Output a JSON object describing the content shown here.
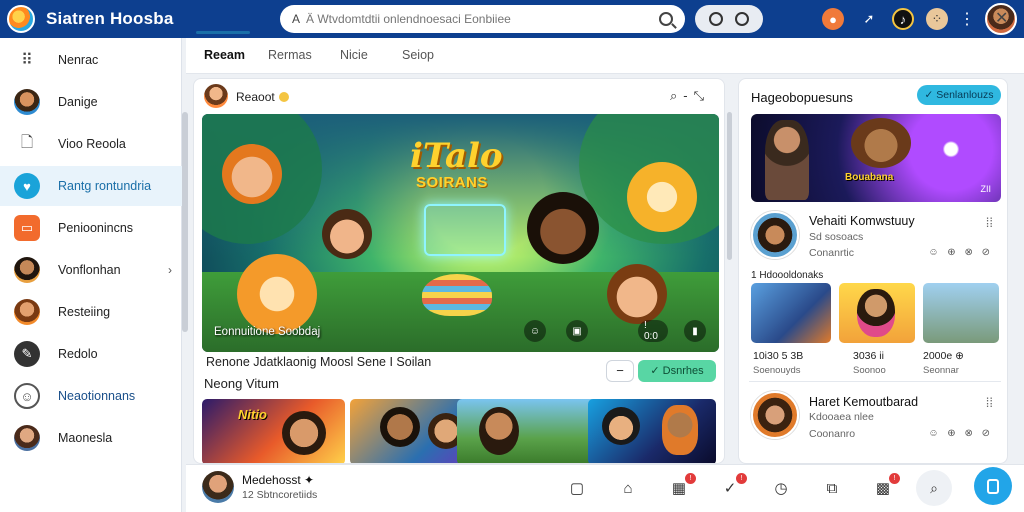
{
  "app": {
    "title": "Siatren Hoosba"
  },
  "search": {
    "placeholder": "Ä Wtvdomtdtii onlendnoesaci Eonbiiee",
    "pre_icon": "A"
  },
  "sidebar": {
    "items": [
      {
        "label": "Nenrac",
        "icon": "grid-icon"
      },
      {
        "label": "Danige",
        "icon": "avatar-icon"
      },
      {
        "label": "Vioo Reoola",
        "icon": "document-icon"
      },
      {
        "label": "Rantg rontundria",
        "icon": "heart-icon",
        "active": true
      },
      {
        "label": "Penioonincns",
        "icon": "chat-icon"
      },
      {
        "label": "Vonflonhan",
        "icon": "avatar-icon"
      },
      {
        "label": "Resteiing",
        "icon": "avatar-icon"
      },
      {
        "label": "Redolo",
        "icon": "pencil-icon"
      },
      {
        "label": "Neaotionnans",
        "icon": "face-icon"
      },
      {
        "label": "Maonesla",
        "icon": "avatar-icon"
      }
    ]
  },
  "tabs": [
    {
      "label": "Reeam",
      "active": true
    },
    {
      "label": "Rermas"
    },
    {
      "label": "Nicie"
    },
    {
      "label": "Seiop"
    }
  ],
  "main": {
    "header_name": "Reaoot",
    "hero": {
      "title": "iTalo",
      "subtitle": "SOIRANS",
      "caption": "Eonnuitione Soobdaj",
      "ctrl_time": "! 0:0"
    },
    "info_line": "Renone Jdatklaonig Moosl Sene I Soilan",
    "section_title": "Neong Vitum",
    "green_button": "✓ Dsnrhes",
    "thumbnails": [
      {
        "label": "Nitio"
      },
      {
        "label": ""
      },
      {
        "label": ""
      },
      {
        "label": ""
      }
    ]
  },
  "right_panel": {
    "title": "Hageobopuesuns",
    "button": "✓ Senlanlouzs",
    "banner": {
      "label": "Bouabana",
      "tag": "ZII"
    },
    "entries": [
      {
        "name": "Vehaiti Komwstuuy",
        "sub1": "Sd sosoacs",
        "sub2": "Conanrtic",
        "reacts": "☺ ⊕ ⊗ ⊘"
      },
      {
        "name": "Haret Kemoutbarad",
        "sub1": "Kdooaea nlee",
        "sub2": "Coonanro",
        "reacts": "☺ ⊕ ⊗ ⊘"
      }
    ],
    "count": "1 Hdoooldonaks",
    "minis": [
      {
        "value": "10i30 5 3B",
        "sub": "Soenouyds"
      },
      {
        "value": "3036 ii",
        "sub": "Soonoo"
      },
      {
        "value": "2000e ⊕",
        "sub": "Seonnar"
      }
    ]
  },
  "bottom": {
    "user_name": "Medehosst ✦",
    "user_sub": "12 Sbtncoretiids"
  }
}
